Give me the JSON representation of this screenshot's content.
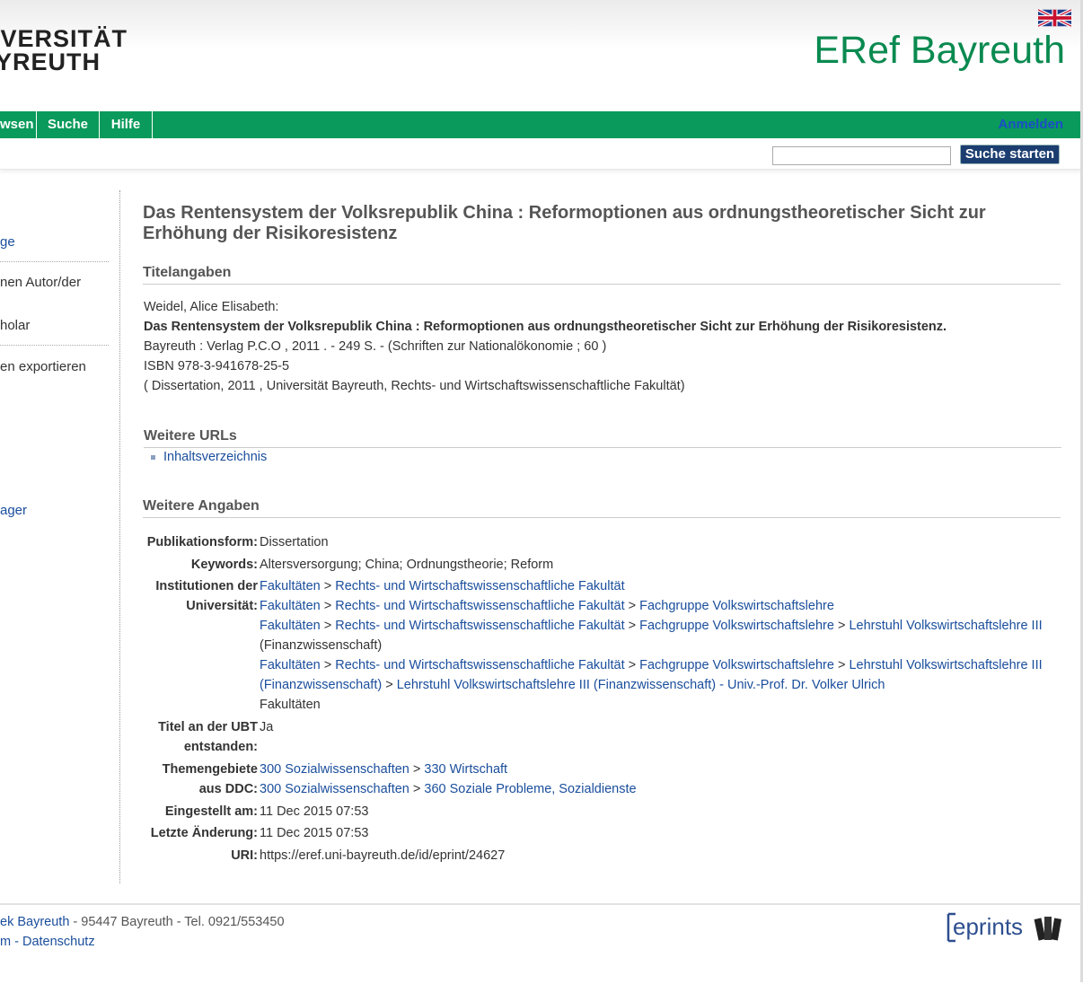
{
  "header": {
    "logo_line1": "IVERSITÄT",
    "logo_line2": "YREUTH",
    "site_title": "ERef Bayreuth",
    "language_flag": "uk-flag-icon"
  },
  "nav": {
    "items": [
      "wsen",
      "Suche",
      "Hilfe"
    ],
    "login": "Anmelden"
  },
  "search": {
    "value": "",
    "button": "Suche starten"
  },
  "sidebar": {
    "items": [
      "ge",
      "nen Autor/der",
      "holar",
      "en exportieren",
      "ager"
    ]
  },
  "record": {
    "title": "Das Rentensystem der Volksrepublik China : Reformoptionen aus ordnungstheoretischer Sicht zur Erhöhung der Risikoresistenz",
    "sections": {
      "titelangaben": "Titelangaben",
      "weitere_urls": "Weitere URLs",
      "weitere_angaben": "Weitere Angaben"
    },
    "citation": {
      "author": "Weidel, Alice Elisabeth:",
      "title": "Das Rentensystem der Volksrepublik China : Reformoptionen aus ordnungstheoretischer Sicht zur Erhöhung der Risikoresistenz.",
      "publisher": "Bayreuth : Verlag P.C.O , 2011 . - 249 S. - (Schriften zur Nationalökonomie ; 60 )",
      "isbn": "ISBN 978-3-941678-25-5",
      "thesis": "( Dissertation, 2011 , Universität Bayreuth, Rechts- und Wirtschaftswissenschaftliche Fakultät)"
    },
    "urls": [
      "Inhaltsverzeichnis"
    ],
    "details": {
      "pubform_label": "Publikationsform:",
      "pubform_value": "Dissertation",
      "keywords_label": "Keywords:",
      "keywords_value": "Altersversorgung; China; Ordnungstheorie; Reform",
      "inst_label_1": "Institutionen der",
      "inst_label_2": "Universität:",
      "inst": {
        "fak": "Fakultäten",
        "rw": "Rechts- und Wirtschaftswissenschaftliche Fakultät",
        "vwl": "Fachgruppe Volkswirtschaftslehre",
        "ls1": "Lehrstuhl Volkswirtschaftslehre III",
        "ls2": "(Finanzwissenschaft)",
        "ulrich": "Lehrstuhl Volkswirtschaftslehre III (Finanzwissenschaft) - Univ.-Prof. Dr. Volker Ulrich",
        "gt": ">"
      },
      "ubt_label_1": "Titel an der UBT",
      "ubt_label_2": "entstanden:",
      "ubt_value": "Ja",
      "ddc_label_1": "Themengebiete",
      "ddc_label_2": "aus DDC:",
      "ddc": {
        "sozial": "300 Sozialwissenschaften",
        "wirtschaft": "330 Wirtschaft",
        "probleme": "360 Soziale Probleme, Sozialdienste"
      },
      "created_label": "Eingestellt am:",
      "created_value": "11 Dec 2015 07:53",
      "modified_label": "Letzte Änderung:",
      "modified_value": "11 Dec 2015 07:53",
      "uri_label": "URI:",
      "uri_value": "https://eref.uni-bayreuth.de/id/eprint/24627"
    }
  },
  "footer": {
    "library": "ek Bayreuth",
    "address": " - 95447 Bayreuth - Tel. 0921/553450",
    "impressum": "m",
    "dash": " - ",
    "datenschutz": "Datenschutz",
    "eprints_logo": "eprints"
  },
  "colors": {
    "brand_green": "#0a9a5b",
    "title_green": "#0a8a50",
    "link_blue": "#1a4e9c",
    "button_navy": "#1c3d70"
  }
}
